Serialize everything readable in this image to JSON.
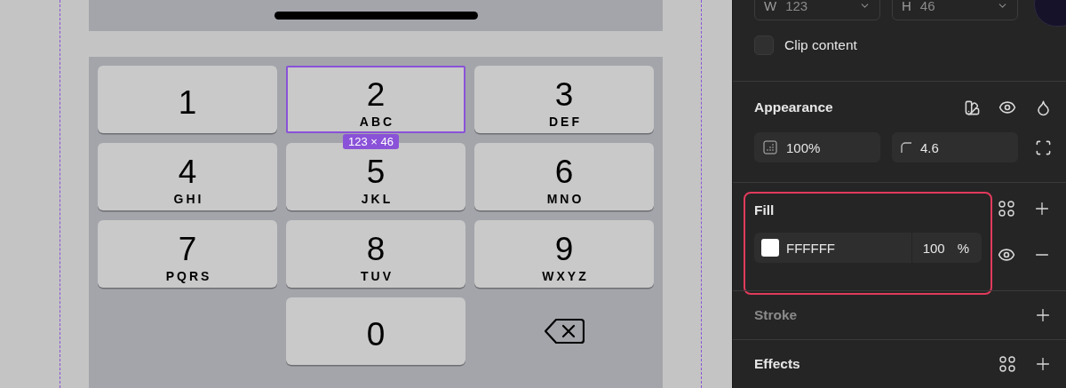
{
  "canvas": {
    "size_badge": "123 × 46",
    "keys": [
      {
        "kind": "key",
        "digit": "1",
        "selected": false
      },
      {
        "kind": "key",
        "digit": "2",
        "letters": "ABC",
        "selected": true
      },
      {
        "kind": "key",
        "digit": "3",
        "letters": "DEF",
        "selected": false
      },
      {
        "kind": "key",
        "digit": "4",
        "letters": "GHI",
        "selected": false
      },
      {
        "kind": "key",
        "digit": "5",
        "letters": "JKL",
        "selected": false
      },
      {
        "kind": "key",
        "digit": "6",
        "letters": "MNO",
        "selected": false
      },
      {
        "kind": "key",
        "digit": "7",
        "letters": "PQRS",
        "selected": false
      },
      {
        "kind": "key",
        "digit": "8",
        "letters": "TUV",
        "selected": false
      },
      {
        "kind": "key",
        "digit": "9",
        "letters": "WXYZ",
        "selected": false
      },
      {
        "kind": "blank"
      },
      {
        "kind": "key",
        "digit": "0",
        "selected": false
      },
      {
        "kind": "delete"
      }
    ]
  },
  "panel": {
    "width": {
      "label": "W",
      "value": "123"
    },
    "height": {
      "label": "H",
      "value": "46"
    },
    "clip_content": {
      "label": "Clip content",
      "checked": false
    },
    "appearance": {
      "title": "Appearance",
      "opacity": "100%",
      "radius": "4.6"
    },
    "fill": {
      "title": "Fill",
      "highlighted": true,
      "hex": "FFFFFF",
      "color": "#ffffff",
      "opacity": "100",
      "unit": "%"
    },
    "stroke": {
      "title": "Stroke",
      "muted": true
    },
    "effects": {
      "title": "Effects",
      "muted": false
    }
  }
}
